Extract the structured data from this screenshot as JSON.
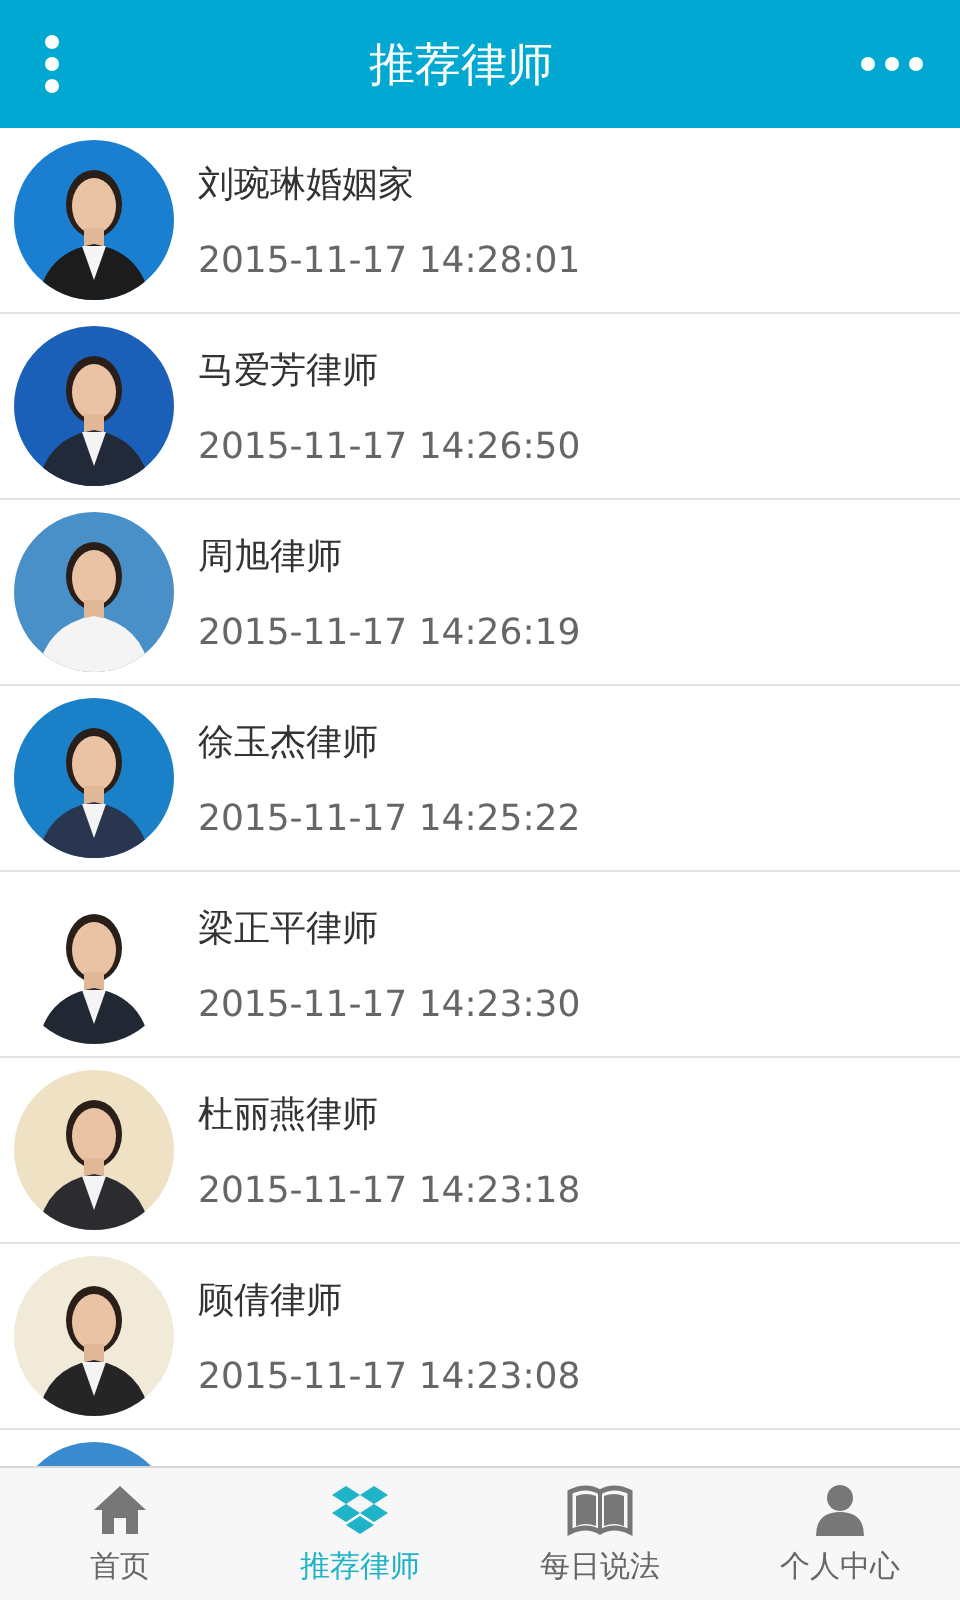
{
  "header": {
    "title": "推荐律师"
  },
  "lawyers": [
    {
      "name": "刘琬琳婚姻家",
      "time": "2015-11-17 14:28:01",
      "kind": "picture"
    },
    {
      "name": "马爱芳律师",
      "time": "2015-11-17 14:26:50",
      "kind": "picture"
    },
    {
      "name": "周旭律师",
      "time": "2015-11-17 14:26:19",
      "kind": "picture"
    },
    {
      "name": "徐玉杰律师",
      "time": "2015-11-17 14:25:22",
      "kind": "picture"
    },
    {
      "name": "梁正平律师",
      "time": "2015-11-17 14:23:30",
      "kind": "picture"
    },
    {
      "name": "杜丽燕律师",
      "time": "2015-11-17 14:23:18",
      "kind": "picture"
    },
    {
      "name": "顾倩律师",
      "time": "2015-11-17 14:23:08",
      "kind": "picture"
    },
    {
      "kind": "picture"
    }
  ],
  "tabs": [
    {
      "label": "首页",
      "kind": "home",
      "selected": false
    },
    {
      "label": "推荐律师",
      "kind": "box",
      "selected": true
    },
    {
      "label": "每日说法",
      "kind": "book",
      "selected": false
    },
    {
      "label": "个人中心",
      "kind": "person",
      "selected": false
    }
  ]
}
